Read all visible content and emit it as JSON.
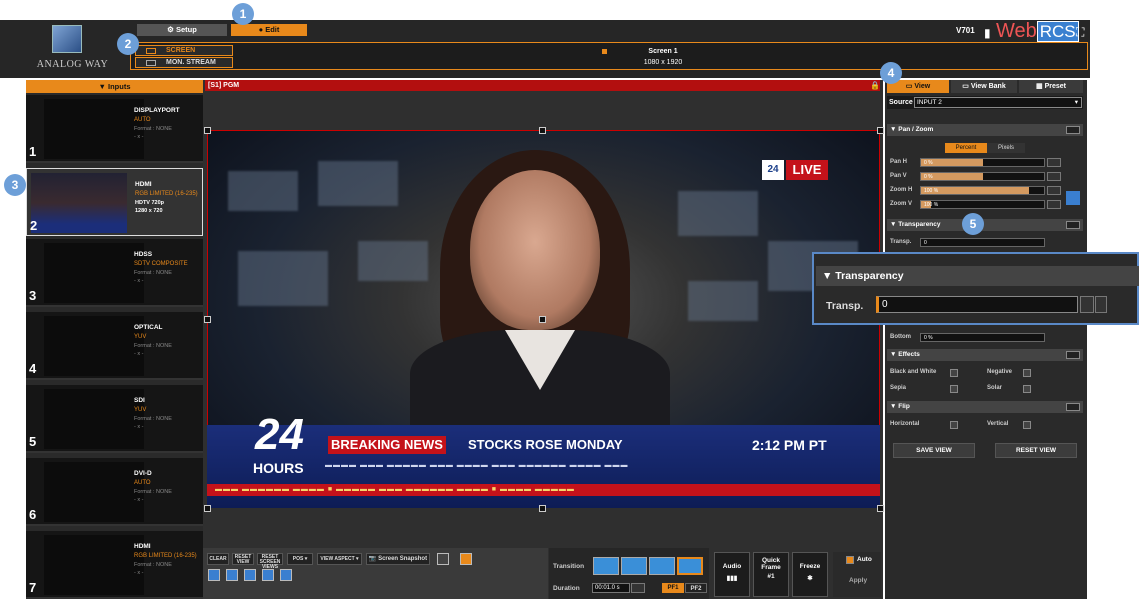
{
  "brand": {
    "logo_text": "ANALOG WAY",
    "version": "V701",
    "product_a": "Web",
    "product_b": "RCS"
  },
  "top_tabs": {
    "setup": "Setup",
    "edit": "Edit"
  },
  "screens": {
    "screen": "SCREEN",
    "mon_stream": "MON. STREAM",
    "screen1_title": "Screen 1",
    "screen1_res": "1080 x 1920"
  },
  "inputs": {
    "header": "Inputs",
    "items": [
      {
        "num": "1",
        "name": "DISPLAYPORT",
        "signal": "AUTO",
        "format": "Format : NONE",
        "res": "- x -"
      },
      {
        "num": "2",
        "name": "HDMI",
        "signal": "RGB LIMITED (16-235)",
        "format": "HDTV 720p",
        "res": "1280 x 720"
      },
      {
        "num": "3",
        "name": "HDSS",
        "signal": "SDTV COMPOSITE",
        "format": "Format : NONE",
        "res": "- x -"
      },
      {
        "num": "4",
        "name": "OPTICAL",
        "signal": "YUV",
        "format": "Format : NONE",
        "res": "- x -"
      },
      {
        "num": "5",
        "name": "SDI",
        "signal": "YUV",
        "format": "Format : NONE",
        "res": "- x -"
      },
      {
        "num": "6",
        "name": "DVI-D",
        "signal": "AUTO",
        "format": "Format : NONE",
        "res": "- x -"
      },
      {
        "num": "7",
        "name": "HDMI",
        "signal": "RGB LIMITED (16-235)",
        "format": "Format : NONE",
        "res": "- x -"
      }
    ]
  },
  "program": {
    "label": "[S1] PGM",
    "live": "LIVE",
    "channel_logo": "24",
    "lower_third_num": "24",
    "lower_third_hours": "HOURS",
    "breaking": "BREAKING NEWS",
    "headline": "STOCKS ROSE MONDAY",
    "time": "2:12 PM PT"
  },
  "toolbar": {
    "clear": "CLEAR",
    "reset_view": "RESET VIEW",
    "reset_screen_views": "RESET SCREEN VIEWS",
    "pos": "POS",
    "view_aspect": "VIEW ASPECT",
    "screen_snapshot": "Screen Snapshot"
  },
  "transition": {
    "label": "Transition",
    "duration_label": "Duration",
    "duration_value": "00:01.0 s",
    "pf1": "PF1",
    "pf2": "PF2",
    "audio": "Audio",
    "quick_frame": "Quick Frame",
    "quick_frame_num": "#1",
    "freeze": "Freeze",
    "auto": "Auto",
    "apply": "Apply"
  },
  "right": {
    "tabs": {
      "view": "View",
      "view_bank": "View Bank",
      "preset": "Preset"
    },
    "source_label": "Source",
    "source_value": "INPUT 2",
    "pan_zoom": {
      "title": "▼ Pan / Zoom",
      "percent": "Percent",
      "pixels": "Pixels",
      "rows": [
        {
          "label": "Pan H",
          "value": "0 %",
          "fill": 0.5
        },
        {
          "label": "Pan V",
          "value": "0 %",
          "fill": 0.5
        },
        {
          "label": "Zoom H",
          "value": "100 %",
          "fill": 0.88
        },
        {
          "label": "Zoom V",
          "value": "100 %",
          "fill": 0.08
        }
      ]
    },
    "transparency": {
      "title": "▼ Transparency",
      "label": "Transp.",
      "value": "0"
    },
    "bottom": {
      "label": "Bottom",
      "value": "0 %"
    },
    "effects": {
      "title": "▼ Effects",
      "bw": "Black and White",
      "negative": "Negative",
      "sepia": "Sepia",
      "solar": "Solar"
    },
    "flip": {
      "title": "▼ Flip",
      "horizontal": "Horizontal",
      "vertical": "Vertical"
    },
    "save_view": "SAVE VIEW",
    "reset_view": "RESET VIEW"
  },
  "callout": {
    "title": "▼ Transparency",
    "label": "Transp.",
    "value": "0"
  },
  "badges": [
    "1",
    "2",
    "3",
    "4",
    "5"
  ],
  "colors": {
    "accent": "#e8891b",
    "pgm_red": "#b30f0f",
    "badge_blue": "#6d9fd8"
  }
}
